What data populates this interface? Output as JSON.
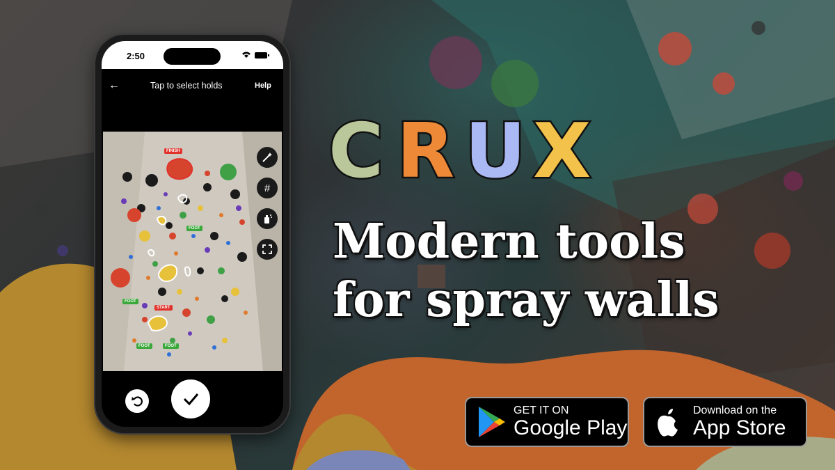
{
  "background": {
    "colors": {
      "orange": "#c1652d",
      "olive": "#b4882f",
      "slate": "#7a86b8",
      "sage": "#a8ab88"
    }
  },
  "brand": {
    "logo_letters": [
      {
        "char": "C",
        "color": "#b9c79a"
      },
      {
        "char": "R",
        "color": "#ee8a37"
      },
      {
        "char": "U",
        "color": "#aab8f3"
      },
      {
        "char": "X",
        "color": "#f2c24a"
      }
    ],
    "tagline_line1": "Modern tools",
    "tagline_line2": "for spray walls"
  },
  "stores": {
    "google": {
      "small": "GET IT ON",
      "big": "Google Play"
    },
    "apple": {
      "small": "Download on the",
      "big": "App Store"
    }
  },
  "phone": {
    "status_time": "2:50",
    "nav": {
      "title": "Tap to select holds",
      "help": "Help"
    },
    "tags": {
      "finish": "FINISH",
      "start": "START",
      "foot": "FOOT"
    },
    "colors": {
      "finish": "#e0322b",
      "start": "#e0322b",
      "foot": "#3aa83a"
    }
  }
}
